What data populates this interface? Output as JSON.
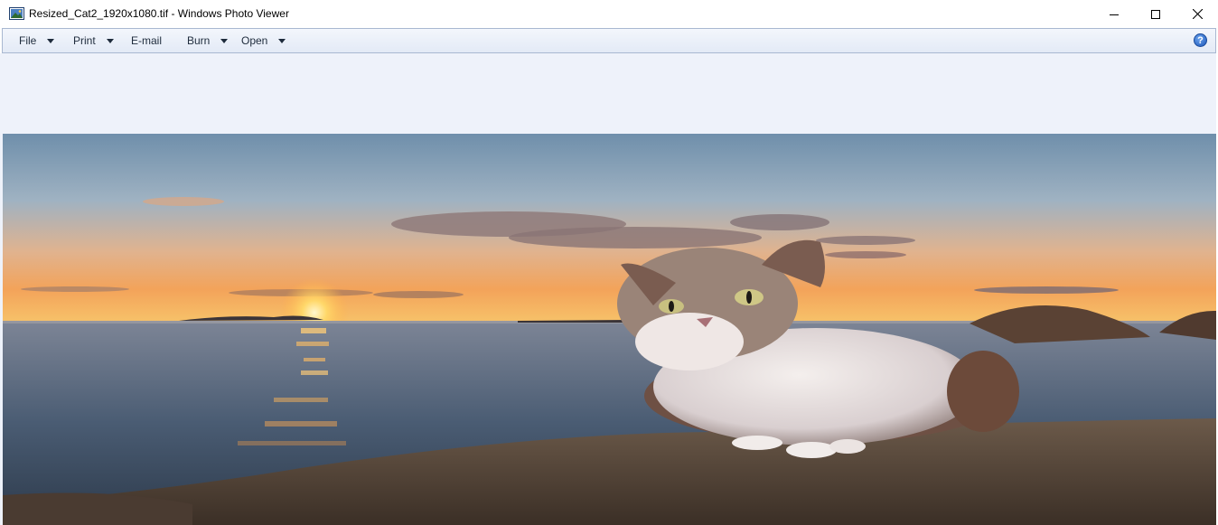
{
  "window": {
    "title": "Resized_Cat2_1920x1080.tif - Windows Photo Viewer",
    "minimize_icon": "minimize-icon",
    "maximize_icon": "maximize-icon",
    "close_icon": "close-icon"
  },
  "menubar": {
    "items": [
      {
        "label": "File",
        "has_dropdown": true
      },
      {
        "label": "Print",
        "has_dropdown": true
      },
      {
        "label": "E-mail",
        "has_dropdown": false
      },
      {
        "label": "Burn",
        "has_dropdown": true
      },
      {
        "label": "Open",
        "has_dropdown": true
      }
    ],
    "help_label": "?"
  },
  "image": {
    "description_icon": "cat-on-rock-at-sunset-photo"
  },
  "colors": {
    "menubar_border": "#a9b8d1",
    "viewer_background": "#eef2fa",
    "help_blue": "#1b55b8"
  }
}
